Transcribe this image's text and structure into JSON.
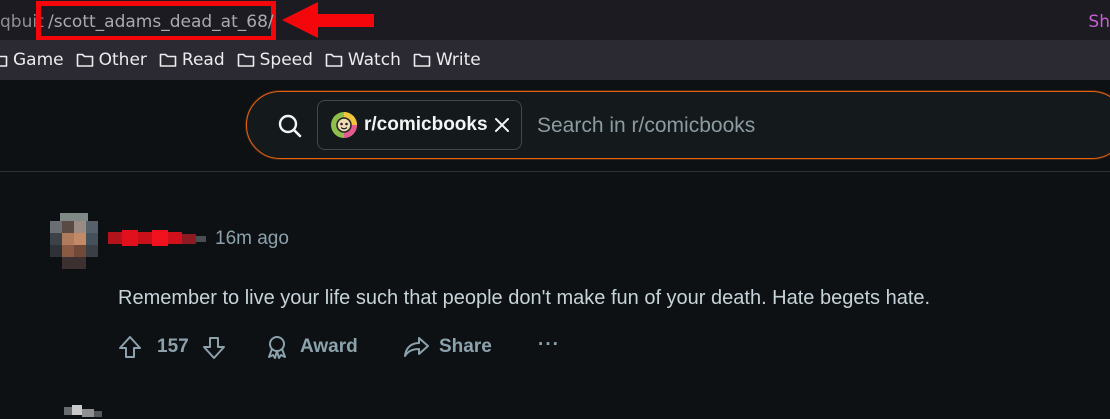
{
  "browser": {
    "url_prefix": "qbuit",
    "url_path": "/scott_adams_dead_at_68/",
    "url_right_fragment": "Sh",
    "bookmarks": [
      {
        "label": "Game"
      },
      {
        "label": "Other"
      },
      {
        "label": "Read"
      },
      {
        "label": "Speed"
      },
      {
        "label": "Watch"
      },
      {
        "label": "Write"
      }
    ]
  },
  "search": {
    "community_chip": "r/comicbooks",
    "placeholder": "Search in r/comicbooks",
    "icon": "search-icon"
  },
  "comment": {
    "timestamp": "16m ago",
    "body": "Remember to live your life such that people don't make fun of your death. Hate begets hate.",
    "votes": "157",
    "award_label": "Award",
    "share_label": "Share",
    "more_label": "···"
  },
  "colors": {
    "annotation_red": "#f4060a",
    "search_border_orange": "#e8620f",
    "background": "#0e1113"
  }
}
